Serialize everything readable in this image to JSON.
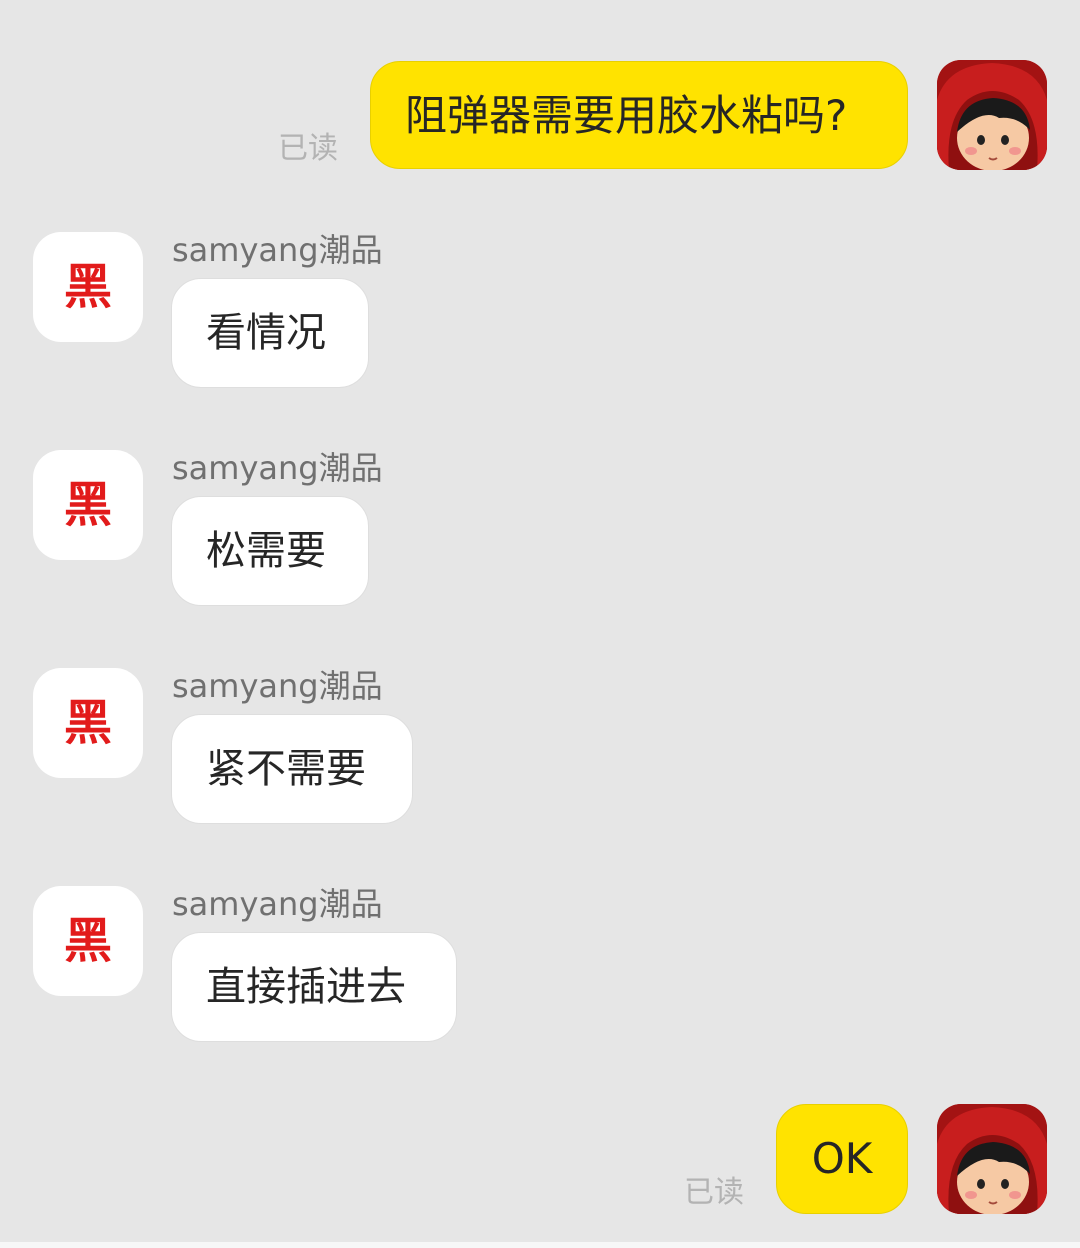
{
  "conversation": {
    "contact_name": "samyang潮品",
    "contact_avatar_glyph": "黑",
    "accent_color": "#ffe300",
    "messages": [
      {
        "from": "me",
        "text": "阻弹器需要用胶水粘吗?",
        "status": "已读"
      },
      {
        "from": "contact",
        "sender": "samyang潮品",
        "text": "看情况"
      },
      {
        "from": "contact",
        "sender": "samyang潮品",
        "text": "松需要"
      },
      {
        "from": "contact",
        "sender": "samyang潮品",
        "text": "紧不需要"
      },
      {
        "from": "contact",
        "sender": "samyang潮品",
        "text": "直接插进去"
      },
      {
        "from": "me",
        "text": "OK",
        "status": "已读"
      }
    ]
  },
  "icons": {
    "my_avatar": "user-avatar-red-hood-icon",
    "contact_avatar": "shop-avatar-icon"
  }
}
